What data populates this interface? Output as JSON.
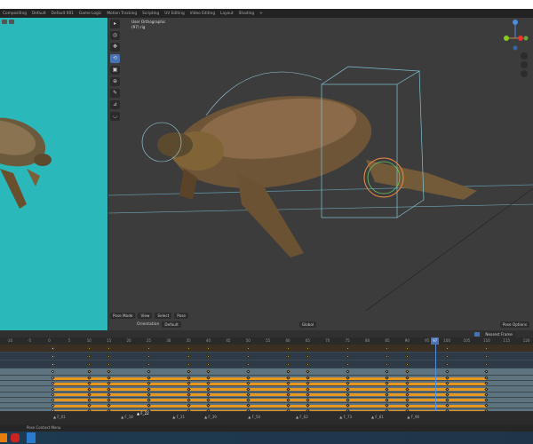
{
  "workspace_tabs": [
    "Compositing",
    "Default",
    "Default 001",
    "Game Logic",
    "Motion Tracking",
    "Scripting",
    "UV Editing",
    "Video Editing",
    "Layout",
    "Shading",
    "+"
  ],
  "viewport": {
    "view_name": "User Orthographic",
    "object_name": "(97) rig",
    "mode": "Pose Mode",
    "menus": [
      "View",
      "Select",
      "Pose"
    ],
    "orientation_label": "Orientation",
    "orientation_value": "Default",
    "transform_orientation": "Global",
    "pose_options": "Pose Options"
  },
  "dopesheet": {
    "snap_mode": "Nearest Frame",
    "current_frame": "97",
    "ruler_ticks": [
      -10,
      -5,
      0,
      5,
      10,
      15,
      20,
      25,
      30,
      35,
      40,
      45,
      50,
      55,
      60,
      65,
      70,
      75,
      80,
      85,
      90,
      95,
      100,
      105,
      110,
      115,
      120
    ],
    "keyframes": [
      1,
      10,
      15,
      25,
      35,
      40,
      50,
      60,
      65,
      75,
      85,
      90,
      100,
      110
    ],
    "markers": [
      {
        "label": "F_01",
        "frame": 1
      },
      {
        "label": "F_18",
        "frame": 18
      },
      {
        "label": "F_22",
        "frame": 22
      },
      {
        "label": "F_31",
        "frame": 31
      },
      {
        "label": "F_39",
        "frame": 39
      },
      {
        "label": "F_50",
        "frame": 50
      },
      {
        "label": "F_62",
        "frame": 62
      },
      {
        "label": "F_73",
        "frame": 73
      },
      {
        "label": "F_81",
        "frame": 81
      },
      {
        "label": "F_90",
        "frame": 90
      }
    ]
  },
  "status": {
    "text": "Pose Context Menu"
  },
  "colors": {
    "accent": "#4772b3",
    "keyframe_bar": "#e8961e",
    "background_teal": "#2bb8ba"
  }
}
